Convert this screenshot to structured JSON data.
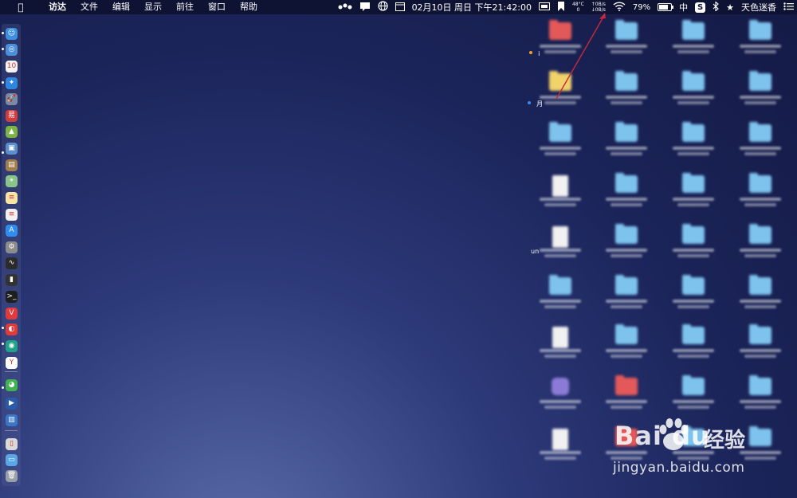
{
  "menubar": {
    "apple_icon": "apple-logo-icon",
    "app_name": "访达",
    "menus": [
      "文件",
      "编辑",
      "显示",
      "前往",
      "窗口",
      "帮助"
    ],
    "status": {
      "datetime": "02月10日 周日 下午21:42:00",
      "cpu_temp": "48°C",
      "cpu_sub": "0",
      "net_up": "↑0B/s",
      "net_down": "↓0B/s",
      "battery": "79%",
      "battery_level": 0.79,
      "ime": "中",
      "s_app": "S",
      "user_name": "天色迷香",
      "list_icon": "list-icon"
    }
  },
  "dock": {
    "icons": [
      {
        "name": "finder",
        "color": "#3d8fe0",
        "glyph": "☺"
      },
      {
        "name": "safari-alt",
        "color": "#4a90d9",
        "glyph": "◎"
      },
      {
        "name": "calendar",
        "color": "#f4f4f4",
        "glyph": "10"
      },
      {
        "name": "safari",
        "color": "#2e86de",
        "glyph": "✦"
      },
      {
        "name": "launchpad",
        "color": "#7a8aa5",
        "glyph": "🚀"
      },
      {
        "name": "netease",
        "color": "#d13c3c",
        "glyph": "易"
      },
      {
        "name": "android",
        "color": "#7cb342",
        "glyph": "▲"
      },
      {
        "name": "preview",
        "color": "#5b8fc9",
        "glyph": "▣"
      },
      {
        "name": "notes-brown",
        "color": "#a37e4c",
        "glyph": "▤"
      },
      {
        "name": "maps",
        "color": "#8bc48a",
        "glyph": "⌖"
      },
      {
        "name": "notes",
        "color": "#f5e6a8",
        "glyph": "≡"
      },
      {
        "name": "textedit",
        "color": "#f0f0f0",
        "glyph": "≡"
      },
      {
        "name": "app-store",
        "color": "#2f8cf0",
        "glyph": "A"
      },
      {
        "name": "system-prefs",
        "color": "#8c8c8c",
        "glyph": "⚙"
      },
      {
        "name": "activity-monitor",
        "color": "#2b2b2b",
        "glyph": "∿"
      },
      {
        "name": "console",
        "color": "#333333",
        "glyph": "▮"
      },
      {
        "name": "terminal",
        "color": "#1f1f1f",
        "glyph": ">_"
      },
      {
        "name": "vivaldi",
        "color": "#e0393e",
        "glyph": "V"
      },
      {
        "name": "netease-music",
        "color": "#e03a3a",
        "glyph": "◐"
      },
      {
        "name": "teamviewer",
        "color": "#1ea388",
        "glyph": "◉"
      },
      {
        "name": "yandex",
        "color": "#ffffff",
        "glyph": "Y"
      },
      {
        "name": "wechat",
        "color": "#3fb34f",
        "glyph": "◕"
      },
      {
        "name": "quicktime",
        "color": "#2b5ba8",
        "glyph": "▶"
      },
      {
        "name": "remote-desktop",
        "color": "#3977c9",
        "glyph": "▥"
      },
      {
        "name": "iphone-backup",
        "color": "#d9d9d9",
        "glyph": "▯"
      },
      {
        "name": "downloads-folder",
        "color": "#5aa7e8",
        "glyph": "▭"
      },
      {
        "name": "trash",
        "color": "#9aa0a8",
        "glyph": "🗑"
      }
    ]
  },
  "desktop": {
    "visible_fragments": [
      "i",
      "月",
      "un"
    ]
  },
  "watermark": {
    "logo": "Bai du",
    "chinese": "经验",
    "url": "jingyan.baidu.com"
  }
}
